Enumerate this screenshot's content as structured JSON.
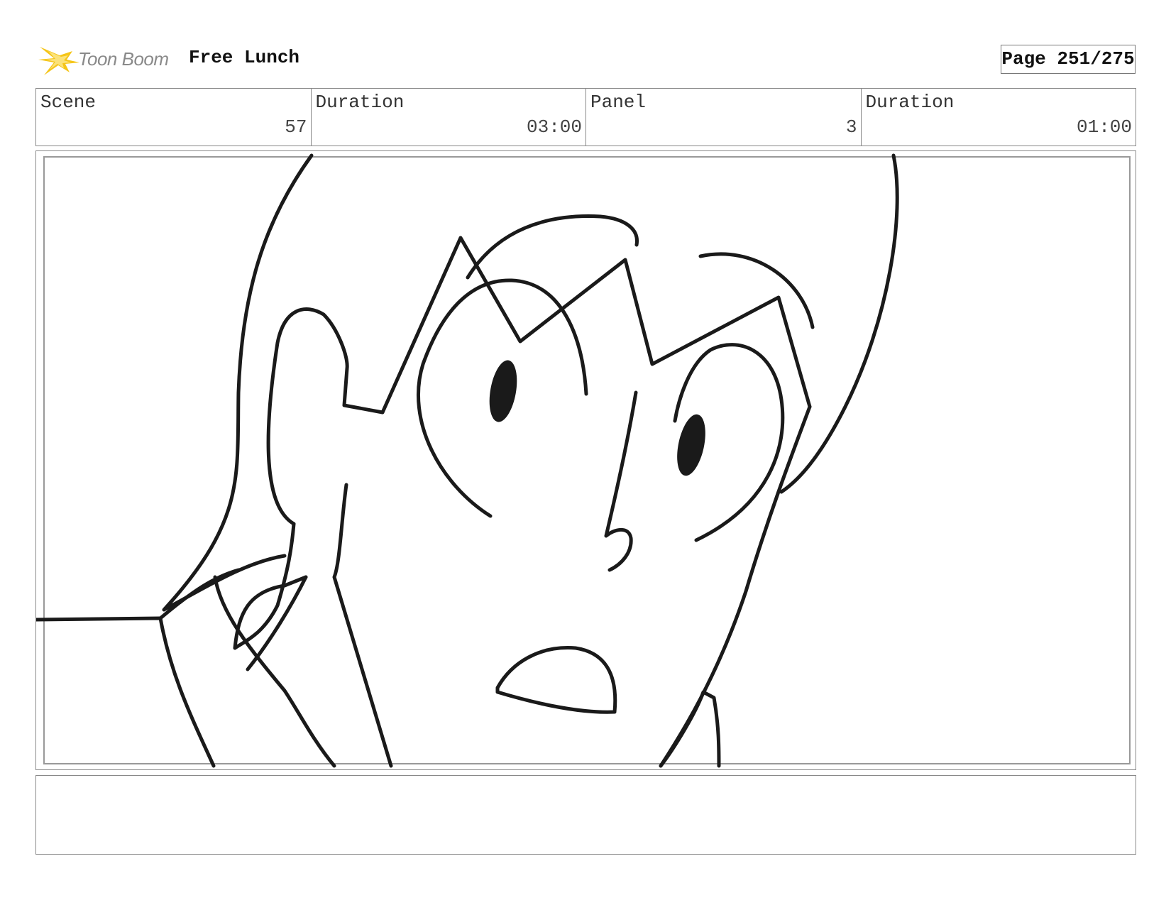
{
  "header": {
    "logo_text": "Toon Boom",
    "project_title": "Free Lunch",
    "page_label": "Page 251/275"
  },
  "info": {
    "scene_label": "Scene",
    "scene_value": "57",
    "scene_duration_label": "Duration",
    "scene_duration_value": "03:00",
    "panel_label": "Panel",
    "panel_value": "3",
    "panel_duration_label": "Duration",
    "panel_duration_value": "01:00"
  },
  "colors": {
    "logo_accent": "#f5c518",
    "border": "#888888",
    "ink": "#1a1a1a"
  },
  "icons": {
    "logo": "toon-boom-starburst-icon"
  },
  "notes": {
    "text": ""
  }
}
